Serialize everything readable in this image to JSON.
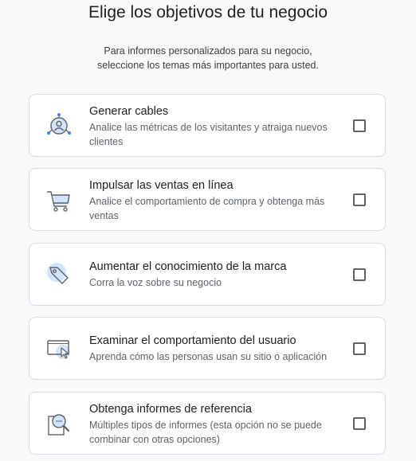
{
  "header": {
    "title": "Elige los objetivos de tu negocio",
    "subtitle_line1": "Para informes personalizados para su negocio,",
    "subtitle_line2": "seleccione los temas más importantes para usted."
  },
  "cards": [
    {
      "title": "Generar cables",
      "desc_line1": "Analice las métricas de los visitantes y atraiga nuevos",
      "desc_line2": "clientes",
      "icon": "leads-icon",
      "checked": false
    },
    {
      "title": "Impulsar las ventas en línea",
      "desc_line1": "Analice el comportamiento de compra y obtenga más",
      "desc_line2": "ventas",
      "icon": "shopping-cart-icon",
      "checked": false
    },
    {
      "title": "Aumentar el conocimiento de la marca",
      "desc_line1": "Corra la voz sobre su negocio",
      "icon": "tag-icon",
      "checked": false
    },
    {
      "title": "Examinar el comportamiento del usuario",
      "desc_line1": "Aprenda cómo las personas usan su sitio o aplicación",
      "icon": "screen-cursor-icon",
      "checked": false
    },
    {
      "title": "Obtenga informes de referencia",
      "desc_line1": "Múltiples tipos de informes (esta opción no se puede",
      "desc_line2": "combinar con otras opciones)",
      "icon": "report-magnifier-icon",
      "checked": false
    }
  ],
  "colors": {
    "accent_light": "#d2e3fc",
    "accent": "#4285f4",
    "icon_stroke": "#5f6368",
    "border": "#dadce0"
  }
}
